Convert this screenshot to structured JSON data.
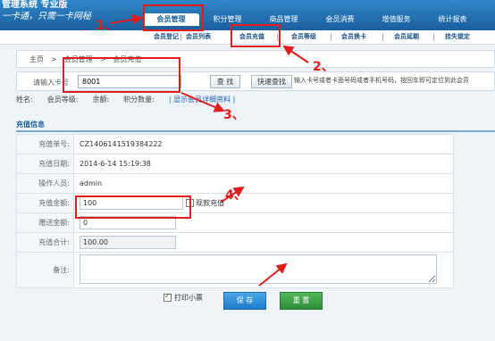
{
  "header": {
    "brand": "管理系统 专业版",
    "slogan": "一卡通，只需一卡网秘",
    "nav": [
      "会员管理",
      "积分管理",
      "商品管理",
      "会员消费",
      "增值服务",
      "统计报表"
    ]
  },
  "subnav": [
    "会员登记",
    "会员列表",
    "会员充值",
    "会员等级",
    "会员换卡",
    "会员延期",
    "挂失锁定"
  ],
  "breadcrumb": {
    "home": "主页",
    "sep": ">",
    "section": "会员管理",
    "page": "会员充值"
  },
  "search": {
    "label": "请输入卡号",
    "value": "8001",
    "btn_find": "查 找",
    "btn_quick": "快速查找",
    "hint": "输入卡号或者卡面号码或者手机号码，按回车即可定位到此会员"
  },
  "member_info": {
    "name_label": "姓名:",
    "level_label": "会员等级:",
    "balance_label": "余额:",
    "points_label": "积分数量:",
    "detail_link": "| 显示会员详细资料 |"
  },
  "section_title": "充值信息",
  "form": {
    "order_no_label": "充值单号:",
    "order_no": "CZ1406141519384222",
    "date_label": "充值日期:",
    "date": "2014-6-14 15:19:38",
    "operator_label": "操作人员:",
    "operator": "admin",
    "amount_label": "充值金额:",
    "amount": "100",
    "cash_label": "现款充值",
    "gift_label": "赠送金额:",
    "gift": "0",
    "total_label": "充值合计:",
    "total": "100.00",
    "memo_label": "备注:",
    "print_label": "打印小票",
    "save": "保 存",
    "reset": "重 置"
  },
  "annotations": [
    "1、",
    "2、",
    "3、",
    "4、"
  ],
  "colors": {
    "annotation": "#e21b1b",
    "header": "#1a5f9e"
  }
}
